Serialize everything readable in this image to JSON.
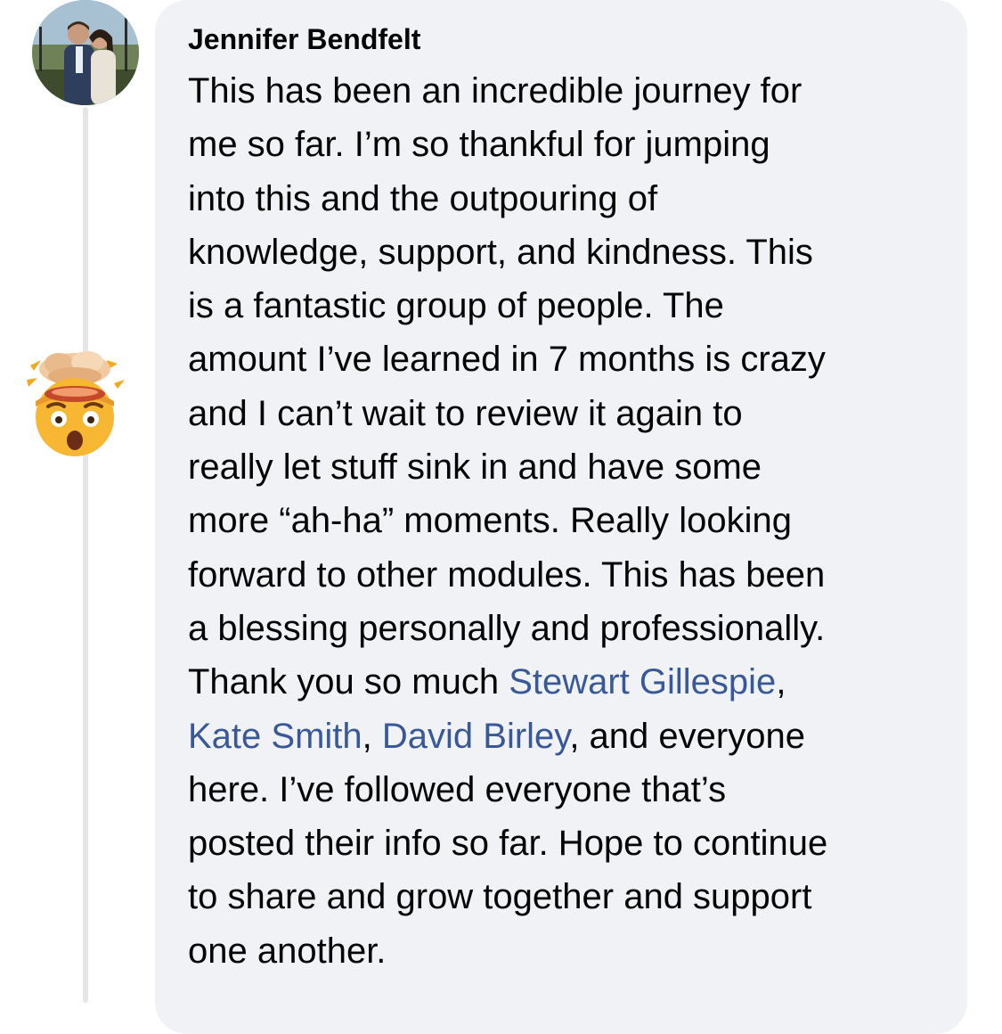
{
  "comment": {
    "author": "Jennifer Bendfelt",
    "avatar_icon": "profile-photo-avatar",
    "reaction_icon": "exploding-head-emoji",
    "mention_color": "#385898",
    "bubble_color": "#f0f2f5",
    "lines": [
      "This has been an incredible journey for",
      "me so far. I’m so thankful for jumping",
      "into this and the outpouring of",
      "knowledge, support, and kindness. This",
      "is a fantastic group of people. The",
      "amount I’ve learned in 7 months is crazy",
      "and I can’t wait to review it again to",
      "really let stuff sink in and have some",
      "more “ah-ha” moments. Really looking",
      "forward to other modules. This has been",
      "a blessing personally and professionally."
    ],
    "line12_prefix": "Thank you so much ",
    "mention_1": "Stewart Gillespie",
    "line12_suffix": ",",
    "mention_2": "Kate Smith",
    "sep_1": ", ",
    "mention_3": "David Birley",
    "line13_suffix": ", and everyone",
    "lines_end": [
      "here. I’ve followed everyone that’s",
      "posted their info so far. Hope to continue",
      "to share and grow together and support",
      "one another."
    ]
  }
}
